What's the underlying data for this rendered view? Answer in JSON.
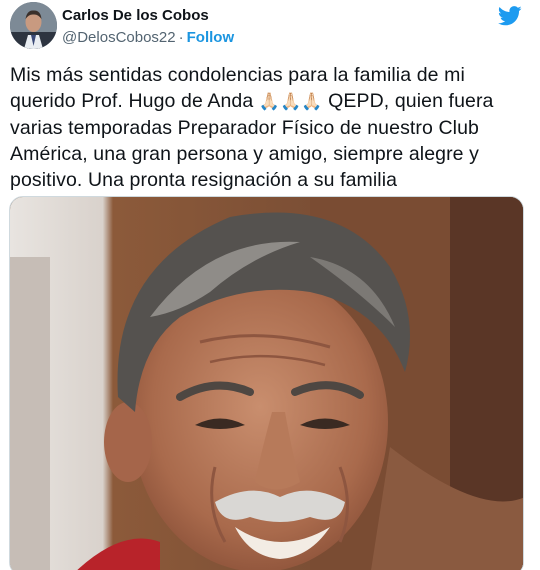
{
  "author": {
    "display_name": "Carlos De los Cobos",
    "handle": "@DelosCobos22",
    "separator": "·",
    "follow_label": "Follow"
  },
  "tweet": {
    "text_before": "Mis más sentidas condolencias para la familia de mi querido Prof. Hugo de Anda ",
    "emoji": "🙏🏻🙏🏻🙏🏻",
    "text_after": " QEPD, quien fuera varias temporadas Preparador Físico de nuestro Club América, una gran persona y amigo, siempre alegre y positivo. Una pronta resignación a su familia"
  },
  "icons": {
    "platform": "twitter-bird-icon",
    "reaction": "folded-hands-icon"
  },
  "colors": {
    "brand": "#1d9bf0",
    "follow": "#1b95e0",
    "text": "#0f1419",
    "secondary": "#536471"
  }
}
